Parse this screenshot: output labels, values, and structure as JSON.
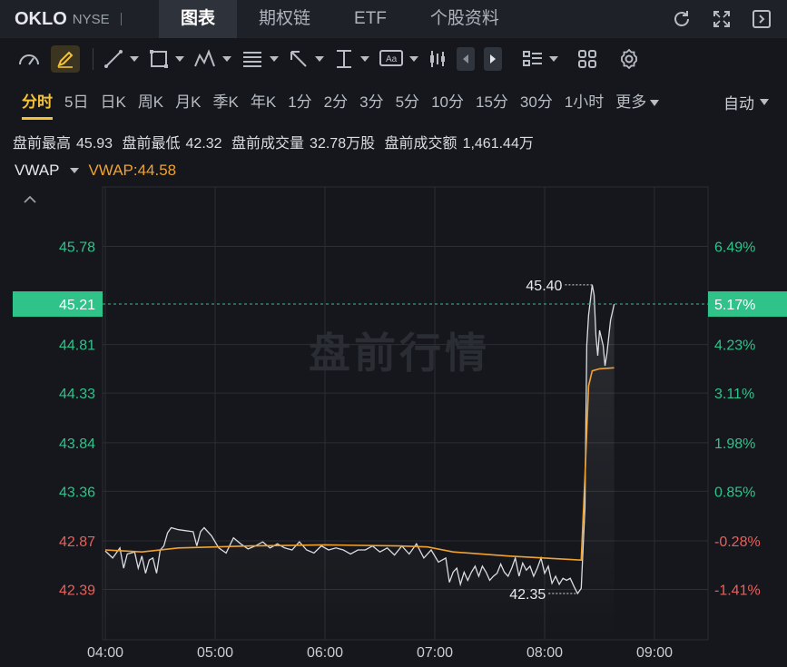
{
  "header": {
    "symbol": "OKLO",
    "exchange": "NYSE",
    "tabs": [
      {
        "label": "图表",
        "active": true
      },
      {
        "label": "期权链",
        "active": false
      },
      {
        "label": "ETF",
        "active": false
      },
      {
        "label": "个股资料",
        "active": false
      }
    ],
    "icons": [
      "refresh-icon",
      "expand-icon",
      "sidebar-toggle-icon"
    ]
  },
  "toolbar": {
    "icons": [
      "gauge-icon",
      "pen-icon",
      "line-tool-icon",
      "rectangle-tool-icon",
      "pattern-tool-icon",
      "fibonacci-tool-icon",
      "arrow-tool-icon",
      "measure-tool-icon",
      "text-tool-icon",
      "candle-style-icon",
      "prev-icon",
      "next-icon",
      "indicator-list-icon",
      "layout-grid-icon",
      "settings-icon"
    ]
  },
  "periods": {
    "items": [
      "分时",
      "5日",
      "日K",
      "周K",
      "月K",
      "季K",
      "年K",
      "1分",
      "2分",
      "3分",
      "5分",
      "10分",
      "15分",
      "30分",
      "1小时",
      "更多"
    ],
    "active": "分时",
    "mode": "自动"
  },
  "stats": {
    "high_label": "盘前最高",
    "high": "45.93",
    "low_label": "盘前最低",
    "low": "42.32",
    "volume_label": "盘前成交量",
    "volume": "32.78万股",
    "amount_label": "盘前成交额",
    "amount": "1,461.44万"
  },
  "indicator": {
    "name": "VWAP",
    "value_text": "VWAP:44.58"
  },
  "watermark": "盘前行情",
  "colors": {
    "up": "#2fc38a",
    "down": "#e8605a",
    "vwap": "#f0a231",
    "price_line": "#d9dce1",
    "accent": "#f3c23a",
    "current_badge": "#2fc38a"
  },
  "chart_data": {
    "type": "line",
    "x_ticks": [
      "04:00",
      "05:00",
      "06:00",
      "07:00",
      "08:00",
      "09:00"
    ],
    "y_ticks_left": [
      "45.78",
      "44.81",
      "44.33",
      "43.84",
      "43.36",
      "42.87",
      "42.39"
    ],
    "y_ticks_right": [
      "6.49%",
      "4.23%",
      "3.11%",
      "1.98%",
      "0.85%",
      "-0.28%",
      "-1.41%"
    ],
    "y_tick_values": [
      45.78,
      44.81,
      44.33,
      43.84,
      43.36,
      42.87,
      42.39
    ],
    "ylim": [
      42.22,
      46.0
    ],
    "xlim_minutes": [
      0,
      330
    ],
    "current_price": "45.21",
    "current_pct": "5.17%",
    "current_value": 45.21,
    "max_label": "45.40",
    "max_value": 45.4,
    "max_minute": 267,
    "min_label": "42.35",
    "min_value": 42.35,
    "min_minute": 258,
    "grid": true,
    "series": [
      {
        "name": "price",
        "points": [
          [
            0,
            42.77
          ],
          [
            4,
            42.7
          ],
          [
            8,
            42.8
          ],
          [
            10,
            42.6
          ],
          [
            12,
            42.74
          ],
          [
            16,
            42.76
          ],
          [
            18,
            42.6
          ],
          [
            20,
            42.72
          ],
          [
            22,
            42.55
          ],
          [
            24,
            42.68
          ],
          [
            26,
            42.7
          ],
          [
            28,
            42.55
          ],
          [
            30,
            42.78
          ],
          [
            32,
            42.82
          ],
          [
            34,
            42.95
          ],
          [
            36,
            43.0
          ],
          [
            40,
            42.98
          ],
          [
            44,
            42.97
          ],
          [
            48,
            42.96
          ],
          [
            50,
            42.82
          ],
          [
            52,
            42.96
          ],
          [
            54,
            43.0
          ],
          [
            58,
            42.92
          ],
          [
            62,
            42.8
          ],
          [
            66,
            42.75
          ],
          [
            70,
            42.9
          ],
          [
            74,
            42.84
          ],
          [
            78,
            42.79
          ],
          [
            82,
            42.82
          ],
          [
            86,
            42.86
          ],
          [
            90,
            42.8
          ],
          [
            94,
            42.84
          ],
          [
            98,
            42.8
          ],
          [
            102,
            42.78
          ],
          [
            106,
            42.86
          ],
          [
            110,
            42.78
          ],
          [
            114,
            42.75
          ],
          [
            118,
            42.82
          ],
          [
            122,
            42.78
          ],
          [
            126,
            42.8
          ],
          [
            130,
            42.78
          ],
          [
            134,
            42.74
          ],
          [
            138,
            42.78
          ],
          [
            142,
            42.78
          ],
          [
            146,
            42.82
          ],
          [
            150,
            42.76
          ],
          [
            154,
            42.8
          ],
          [
            158,
            42.73
          ],
          [
            162,
            42.82
          ],
          [
            166,
            42.74
          ],
          [
            170,
            42.84
          ],
          [
            174,
            42.7
          ],
          [
            178,
            42.78
          ],
          [
            182,
            42.66
          ],
          [
            186,
            42.7
          ],
          [
            188,
            42.46
          ],
          [
            190,
            42.56
          ],
          [
            192,
            42.6
          ],
          [
            194,
            42.44
          ],
          [
            196,
            42.56
          ],
          [
            198,
            42.48
          ],
          [
            200,
            42.56
          ],
          [
            202,
            42.62
          ],
          [
            204,
            42.52
          ],
          [
            206,
            42.62
          ],
          [
            208,
            42.56
          ],
          [
            210,
            42.48
          ],
          [
            212,
            42.52
          ],
          [
            214,
            42.55
          ],
          [
            216,
            42.64
          ],
          [
            218,
            42.56
          ],
          [
            220,
            42.52
          ],
          [
            222,
            42.6
          ],
          [
            224,
            42.7
          ],
          [
            226,
            42.52
          ],
          [
            228,
            42.65
          ],
          [
            230,
            42.58
          ],
          [
            232,
            42.62
          ],
          [
            234,
            42.52
          ],
          [
            236,
            42.6
          ],
          [
            238,
            42.7
          ],
          [
            240,
            42.55
          ],
          [
            242,
            42.62
          ],
          [
            244,
            42.45
          ],
          [
            246,
            42.52
          ],
          [
            248,
            42.44
          ],
          [
            250,
            42.5
          ],
          [
            252,
            42.48
          ],
          [
            254,
            42.5
          ],
          [
            256,
            42.42
          ],
          [
            258,
            42.35
          ],
          [
            260,
            42.4
          ],
          [
            262,
            43.2
          ],
          [
            263,
            44.8
          ],
          [
            264,
            45.1
          ],
          [
            266,
            45.4
          ],
          [
            267,
            45.3
          ],
          [
            268,
            44.9
          ],
          [
            269,
            44.7
          ],
          [
            270,
            44.95
          ],
          [
            272,
            44.8
          ],
          [
            273,
            44.6
          ],
          [
            274,
            44.72
          ],
          [
            276,
            45.05
          ],
          [
            278,
            45.21
          ]
        ]
      },
      {
        "name": "VWAP",
        "points": [
          [
            0,
            42.78
          ],
          [
            20,
            42.76
          ],
          [
            40,
            42.8
          ],
          [
            80,
            42.82
          ],
          [
            120,
            42.83
          ],
          [
            160,
            42.82
          ],
          [
            176,
            42.81
          ],
          [
            190,
            42.76
          ],
          [
            220,
            42.72
          ],
          [
            240,
            42.7
          ],
          [
            260,
            42.68
          ],
          [
            262,
            43.5
          ],
          [
            264,
            44.4
          ],
          [
            266,
            44.55
          ],
          [
            270,
            44.57
          ],
          [
            278,
            44.58
          ]
        ]
      }
    ]
  }
}
